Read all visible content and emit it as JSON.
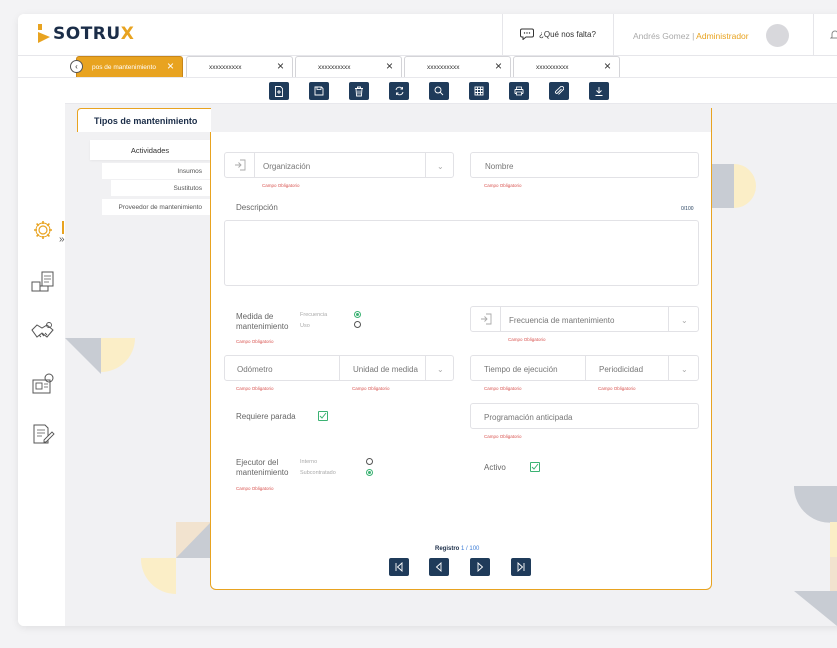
{
  "app": {
    "logo_prefix": "SOTRU",
    "logo_suffix": "X",
    "feedback": "¿Qué nos falta?",
    "user_name": "Andrés Gomez",
    "user_sep": " | ",
    "user_role": "Administrador"
  },
  "tabs": [
    {
      "label": "pos de mantenimiento",
      "active": true
    },
    {
      "label": "xxxxxxxxxx",
      "active": false
    },
    {
      "label": "xxxxxxxxxx",
      "active": false
    },
    {
      "label": "xxxxxxxxxx",
      "active": false
    },
    {
      "label": "xxxxxxxxxx",
      "active": false
    }
  ],
  "toolbar_icons": [
    "new-document-icon",
    "save-icon",
    "trash-icon",
    "refresh-icon",
    "search-icon",
    "grid-icon",
    "print-icon",
    "attach-icon",
    "download-icon"
  ],
  "sidebar_icons": [
    "gear-icon",
    "inventory-icon",
    "handshake-icon",
    "machine-icon",
    "document-edit-icon"
  ],
  "page": {
    "title": "Tipos de mantenimiento",
    "subnav": {
      "main": "Actividades",
      "items": [
        "Insumos",
        "Sustitutos",
        "Proveedor de mantenimiento"
      ]
    }
  },
  "form": {
    "organizacion": "Organización",
    "nombre": "Nombre",
    "required": "Campo Obligatorio",
    "descripcion": "Descripción",
    "desc_counter": "0/100",
    "medida_label": "Medida de mantenimiento",
    "medida_opt1": "Frecuencia",
    "medida_opt2": "Uso",
    "frecuencia": "Frecuencia de mantenimiento",
    "odometro": "Odómetro",
    "unidad": "Unidad de medida",
    "tiempo": "Tiempo de ejecución",
    "periodicidad": "Periodicidad",
    "requiere_parada": "Requiere parada",
    "programacion": "Programación anticipada",
    "ejecutor_label": "Ejecutor del mantenimiento",
    "ejecutor_opt1": "Interno",
    "ejecutor_opt2": "Subcontratado",
    "activo": "Activo"
  },
  "pager": {
    "label": "Registro",
    "value": "1 / 100"
  },
  "colors": {
    "accent": "#e8a320",
    "navy": "#1f3b5a",
    "success": "#3bb273",
    "error": "#d9534f"
  }
}
